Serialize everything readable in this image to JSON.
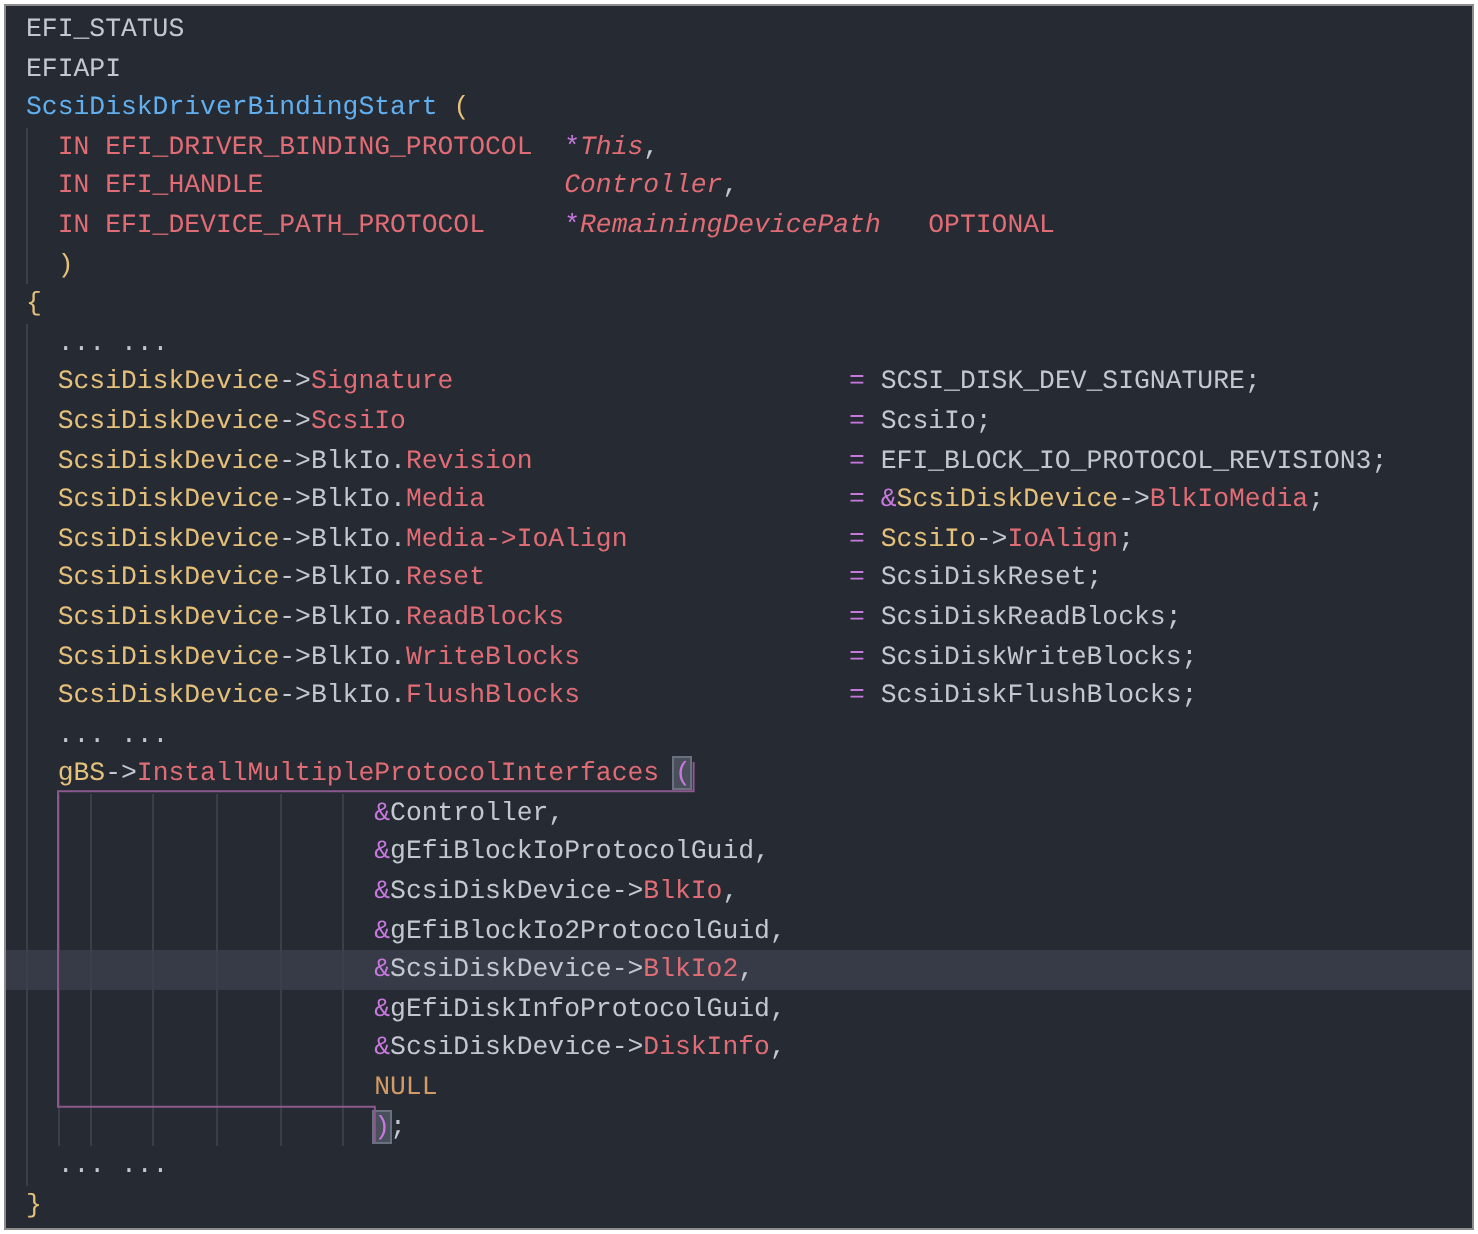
{
  "lines": [
    {
      "tokens": [
        {
          "text": "EFI_STATUS",
          "kind": "plain"
        }
      ]
    },
    {
      "tokens": [
        {
          "text": "EFIAPI",
          "kind": "plain"
        }
      ]
    },
    {
      "tokens": [
        {
          "text": "ScsiDiskDriverBindingStart",
          "kind": "function"
        },
        {
          "text": " (",
          "kind": "bracket"
        }
      ]
    },
    {
      "tokens": [
        {
          "text": "  IN EFI_DRIVER_BINDING_PROTOCOL  ",
          "kind": "macro"
        },
        {
          "text": "*",
          "kind": "operator"
        },
        {
          "text": "This",
          "kind": "parameter"
        },
        {
          "text": ",",
          "kind": "plain"
        }
      ]
    },
    {
      "tokens": [
        {
          "text": "  IN EFI_HANDLE                   ",
          "kind": "macro"
        },
        {
          "text": "Controller",
          "kind": "parameter"
        },
        {
          "text": ",",
          "kind": "plain"
        }
      ]
    },
    {
      "tokens": [
        {
          "text": "  IN EFI_DEVICE_PATH_PROTOCOL     ",
          "kind": "macro"
        },
        {
          "text": "*",
          "kind": "operator"
        },
        {
          "text": "RemainingDevicePath",
          "kind": "parameter"
        },
        {
          "text": "   OPTIONAL",
          "kind": "macro"
        }
      ]
    },
    {
      "tokens": [
        {
          "text": "  )",
          "kind": "bracket"
        }
      ]
    },
    {
      "tokens": [
        {
          "text": "{",
          "kind": "bracket"
        }
      ]
    },
    {
      "tokens": [
        {
          "text": "  ... ...",
          "kind": "plain"
        }
      ]
    },
    {
      "tokens": [
        {
          "text": "  ScsiDiskDevice",
          "kind": "variable"
        },
        {
          "text": "->",
          "kind": "plain"
        },
        {
          "text": "Signature",
          "kind": "member"
        },
        {
          "text": "                         =",
          "kind": "operator"
        },
        {
          "text": " SCSI_DISK_DEV_SIGNATURE;",
          "kind": "plain"
        }
      ]
    },
    {
      "tokens": [
        {
          "text": "  ScsiDiskDevice",
          "kind": "variable"
        },
        {
          "text": "->",
          "kind": "plain"
        },
        {
          "text": "ScsiIo",
          "kind": "member"
        },
        {
          "text": "                            =",
          "kind": "operator"
        },
        {
          "text": " ScsiIo;",
          "kind": "plain"
        }
      ]
    },
    {
      "tokens": [
        {
          "text": "  ScsiDiskDevice",
          "kind": "variable"
        },
        {
          "text": "->BlkIo.",
          "kind": "plain"
        },
        {
          "text": "Revision",
          "kind": "member"
        },
        {
          "text": "                    =",
          "kind": "operator"
        },
        {
          "text": " EFI_BLOCK_IO_PROTOCOL_REVISION3;",
          "kind": "plain"
        }
      ]
    },
    {
      "tokens": [
        {
          "text": "  ScsiDiskDevice",
          "kind": "variable"
        },
        {
          "text": "->BlkIo.",
          "kind": "plain"
        },
        {
          "text": "Media",
          "kind": "member"
        },
        {
          "text": "                       = &",
          "kind": "operator"
        },
        {
          "text": "ScsiDiskDevice",
          "kind": "variable"
        },
        {
          "text": "->",
          "kind": "plain"
        },
        {
          "text": "BlkIoMedia",
          "kind": "member"
        },
        {
          "text": ";",
          "kind": "plain"
        }
      ]
    },
    {
      "tokens": [
        {
          "text": "  ScsiDiskDevice",
          "kind": "variable"
        },
        {
          "text": "->BlkIo.",
          "kind": "plain"
        },
        {
          "text": "Media->IoAlign",
          "kind": "member"
        },
        {
          "text": "              =",
          "kind": "operator"
        },
        {
          "text": " ScsiIo",
          "kind": "variable"
        },
        {
          "text": "->",
          "kind": "plain"
        },
        {
          "text": "IoAlign",
          "kind": "member"
        },
        {
          "text": ";",
          "kind": "plain"
        }
      ]
    },
    {
      "tokens": [
        {
          "text": "  ScsiDiskDevice",
          "kind": "variable"
        },
        {
          "text": "->BlkIo.",
          "kind": "plain"
        },
        {
          "text": "Reset",
          "kind": "member"
        },
        {
          "text": "                       =",
          "kind": "operator"
        },
        {
          "text": " ScsiDiskReset;",
          "kind": "plain"
        }
      ]
    },
    {
      "tokens": [
        {
          "text": "  ScsiDiskDevice",
          "kind": "variable"
        },
        {
          "text": "->BlkIo.",
          "kind": "plain"
        },
        {
          "text": "ReadBlocks",
          "kind": "member"
        },
        {
          "text": "                  =",
          "kind": "operator"
        },
        {
          "text": " ScsiDiskReadBlocks;",
          "kind": "plain"
        }
      ]
    },
    {
      "tokens": [
        {
          "text": "  ScsiDiskDevice",
          "kind": "variable"
        },
        {
          "text": "->BlkIo.",
          "kind": "plain"
        },
        {
          "text": "WriteBlocks",
          "kind": "member"
        },
        {
          "text": "                 =",
          "kind": "operator"
        },
        {
          "text": " ScsiDiskWriteBlocks;",
          "kind": "plain"
        }
      ]
    },
    {
      "tokens": [
        {
          "text": "  ScsiDiskDevice",
          "kind": "variable"
        },
        {
          "text": "->BlkIo.",
          "kind": "plain"
        },
        {
          "text": "FlushBlocks",
          "kind": "member"
        },
        {
          "text": "                 =",
          "kind": "operator"
        },
        {
          "text": " ScsiDiskFlushBlocks;",
          "kind": "plain"
        }
      ]
    },
    {
      "tokens": [
        {
          "text": "  ... ...",
          "kind": "plain"
        }
      ]
    },
    {
      "tokens": [
        {
          "text": "  gBS",
          "kind": "variable"
        },
        {
          "text": "->",
          "kind": "plain"
        },
        {
          "text": "InstallMultipleProtocolInterfaces ",
          "kind": "member"
        },
        {
          "text": "(",
          "kind": "bracket2",
          "matched": true
        }
      ]
    },
    {
      "tokens": [
        {
          "text": "                      &",
          "kind": "operator"
        },
        {
          "text": "Controller,",
          "kind": "plain"
        }
      ]
    },
    {
      "tokens": [
        {
          "text": "                      &",
          "kind": "operator"
        },
        {
          "text": "gEfiBlockIoProtocolGuid,",
          "kind": "plain"
        }
      ]
    },
    {
      "tokens": [
        {
          "text": "                      &",
          "kind": "operator"
        },
        {
          "text": "ScsiDiskDevice->",
          "kind": "plain"
        },
        {
          "text": "BlkIo",
          "kind": "member"
        },
        {
          "text": ",",
          "kind": "plain"
        }
      ]
    },
    {
      "tokens": [
        {
          "text": "                      &",
          "kind": "operator"
        },
        {
          "text": "gEfiBlockIo2ProtocolGuid,",
          "kind": "plain"
        }
      ]
    },
    {
      "current": true,
      "tokens": [
        {
          "text": "                      &",
          "kind": "operator"
        },
        {
          "text": "ScsiDiskDevice->",
          "kind": "plain"
        },
        {
          "text": "BlkIo2",
          "kind": "member"
        },
        {
          "text": ",",
          "kind": "plain"
        }
      ]
    },
    {
      "tokens": [
        {
          "text": "                      &",
          "kind": "operator"
        },
        {
          "text": "gEfiDiskInfoProtocolGuid,",
          "kind": "plain"
        }
      ]
    },
    {
      "tokens": [
        {
          "text": "                      &",
          "kind": "operator"
        },
        {
          "text": "ScsiDiskDevice->",
          "kind": "plain"
        },
        {
          "text": "DiskInfo",
          "kind": "member"
        },
        {
          "text": ",",
          "kind": "plain"
        }
      ]
    },
    {
      "tokens": [
        {
          "text": "                      NULL",
          "kind": "constant"
        }
      ]
    },
    {
      "tokens": [
        {
          "text": "                      )",
          "kind": "bracket2",
          "matched": true
        },
        {
          "text": ";",
          "kind": "plain"
        }
      ]
    },
    {
      "tokens": [
        {
          "text": "  ... ...",
          "kind": "plain"
        }
      ]
    },
    {
      "tokens": [
        {
          "text": "}",
          "kind": "bracket"
        }
      ]
    }
  ]
}
